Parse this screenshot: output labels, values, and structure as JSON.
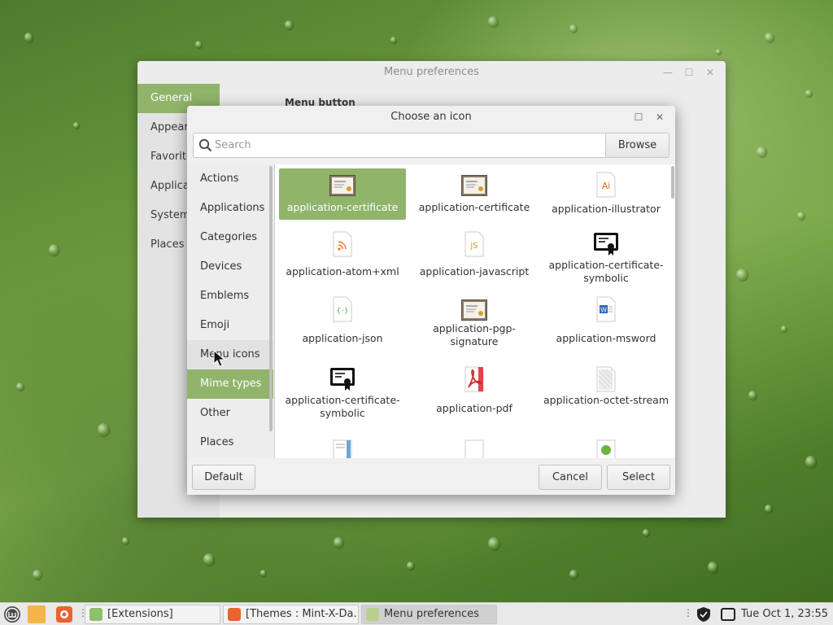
{
  "prefs_window": {
    "title": "Menu preferences",
    "sidebar": [
      "General",
      "Appearance",
      "Favorites",
      "Applications",
      "System",
      "Places"
    ],
    "active_sidebar": "General",
    "section_title": "Menu button"
  },
  "dialog": {
    "title": "Choose an icon",
    "search_placeholder": "Search",
    "browse_label": "Browse",
    "categories": [
      "Actions",
      "Applications",
      "Categories",
      "Devices",
      "Emblems",
      "Emoji",
      "Menu icons",
      "Mime types",
      "Other",
      "Places"
    ],
    "active_category": "Mime types",
    "hover_category": "Menu icons",
    "icons": [
      {
        "label": "application-certificate",
        "icon": "certificate-icon",
        "selected": true
      },
      {
        "label": "application-certificate",
        "icon": "certificate-icon"
      },
      {
        "label": "application-illustrator",
        "icon": "illustrator-icon",
        "glyph": "Ai"
      },
      {
        "label": "application-atom+xml",
        "icon": "rss-icon"
      },
      {
        "label": "application-javascript",
        "icon": "javascript-icon",
        "glyph": "JS"
      },
      {
        "label": "application-certificate-symbolic",
        "icon": "certificate-symbolic-icon"
      },
      {
        "label": "application-json",
        "icon": "json-icon",
        "glyph": "{·}"
      },
      {
        "label": "application-pgp-signature",
        "icon": "certificate-icon"
      },
      {
        "label": "application-msword",
        "icon": "msword-icon",
        "glyph": "W"
      },
      {
        "label": "application-certificate-symbolic",
        "icon": "certificate-symbolic-icon"
      },
      {
        "label": "application-pdf",
        "icon": "pdf-icon"
      },
      {
        "label": "application-octet-stream",
        "icon": "octet-stream-icon"
      }
    ],
    "buttons": {
      "default": "Default",
      "cancel": "Cancel",
      "select": "Select"
    }
  },
  "taskbar": {
    "tasks": [
      "[Extensions]",
      "[Themes : Mint-X-Da...",
      "Menu preferences"
    ],
    "active_task": "Menu preferences",
    "clock": "Tue Oct  1, 23:55"
  }
}
